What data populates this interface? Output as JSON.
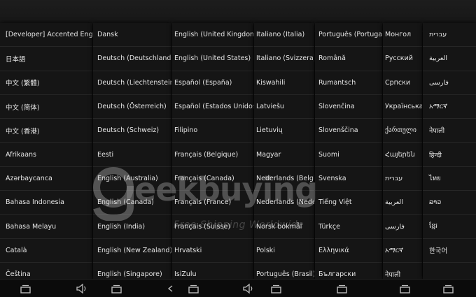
{
  "columns": [
    [
      "[Developer] Accented English",
      "日本語",
      "中文 (繁體)",
      "中文 (简体)",
      "中文 (香港)",
      "Afrikaans",
      "Azərbaycanca",
      "Bahasa Indonesia",
      "Bahasa Melayu",
      "Català",
      "Čeština"
    ],
    [
      "Dansk",
      "Deutsch (Deutschland)",
      "Deutsch (Liechtenstein)",
      "Deutsch (Österreich)",
      "Deutsch (Schweiz)",
      "Eesti",
      "English (Australia)",
      "English (Canada)",
      "English (India)",
      "English (New Zealand)",
      "English (Singapore)"
    ],
    [
      "English (United Kingdom)",
      "English (United States)",
      "Español (España)",
      "Español (Estados Unidos)",
      "Filipino",
      "Français (Belgique)",
      "Français (Canada)",
      "Français (France)",
      "Français (Suisse)",
      "Hrvatski",
      "IsiZulu"
    ],
    [
      "Italiano (Italia)",
      "Italiano (Svizzera)",
      "Kiswahili",
      "Latviešu",
      "Lietuvių",
      "Magyar",
      "Nederlands (België)",
      "Nederlands (Nederland)",
      "Norsk bokmål",
      "Polski",
      "Português (Brasil)"
    ],
    [
      "Português (Portugal)",
      "Română",
      "Rumantsch",
      "Slovenčina",
      "Slovenščina",
      "Suomi",
      "Svenska",
      "Tiếng Việt",
      "Türkçe",
      "Ελληνικά",
      "Български"
    ],
    [
      "Монгол",
      "Русский",
      "Српски",
      "Українська",
      "ქართული",
      "Հայերեն",
      "עברית",
      "العربية",
      "فارسی",
      "አማርኛ",
      "नेपाली"
    ],
    [
      "עברית",
      "العربية",
      "فارسی",
      "አማርኛ",
      "नेपाली",
      "हिन्दी",
      "ไทย",
      "ລາວ",
      "ខ្មែរ",
      "한국어",
      ""
    ]
  ],
  "watermark": {
    "brand": "eekbuying",
    "tagline": "Free Shipping Worldwide"
  },
  "navbar": {
    "icons": [
      "recent-apps-icon",
      "volume-icon",
      "recent-apps-icon",
      "back-icon",
      "recent-apps-icon",
      "volume-icon",
      "recent-apps-icon",
      "recent-apps-icon"
    ]
  }
}
